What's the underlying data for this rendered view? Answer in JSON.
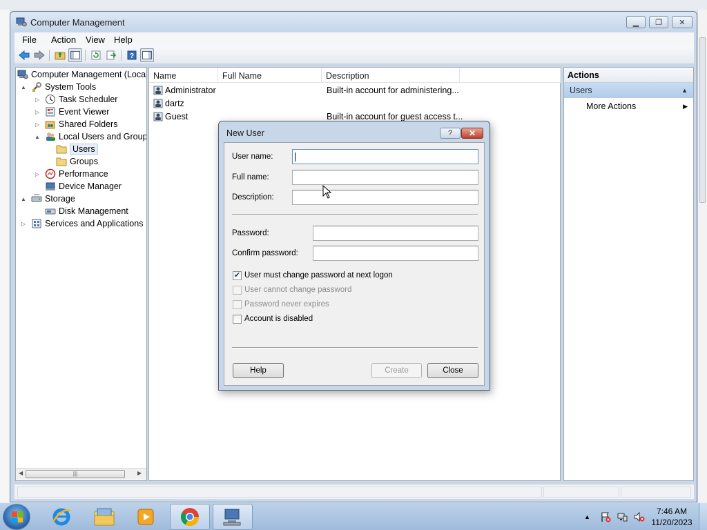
{
  "window": {
    "title": "Computer Management"
  },
  "menu": [
    "File",
    "Action",
    "View",
    "Help"
  ],
  "tree": {
    "items": [
      {
        "label": "Computer Management (Local",
        "expander": "",
        "icon": "computer-management-icon"
      },
      {
        "label": "System Tools",
        "expander": "▲",
        "icon": "system-tools-icon"
      },
      {
        "label": "Task Scheduler",
        "expander": "▷",
        "icon": "task-scheduler-icon"
      },
      {
        "label": "Event Viewer",
        "expander": "▷",
        "icon": "event-viewer-icon"
      },
      {
        "label": "Shared Folders",
        "expander": "▷",
        "icon": "shared-folders-icon"
      },
      {
        "label": "Local Users and Groups",
        "expander": "▲",
        "icon": "local-users-groups-icon"
      },
      {
        "label": "Users",
        "expander": "",
        "icon": "folder-icon"
      },
      {
        "label": "Groups",
        "expander": "",
        "icon": "folder-icon"
      },
      {
        "label": "Performance",
        "expander": "▷",
        "icon": "performance-icon"
      },
      {
        "label": "Device Manager",
        "expander": "",
        "icon": "device-manager-icon"
      },
      {
        "label": "Storage",
        "expander": "▲",
        "icon": "storage-icon"
      },
      {
        "label": "Disk Management",
        "expander": "",
        "icon": "disk-management-icon"
      },
      {
        "label": "Services and Applications",
        "expander": "▷",
        "icon": "services-applications-icon"
      }
    ]
  },
  "list": {
    "columns": [
      "Name",
      "Full Name",
      "Description"
    ],
    "rows": [
      {
        "name": "Administrator",
        "full_name": "",
        "description": "Built-in account for administering..."
      },
      {
        "name": "dartz",
        "full_name": "",
        "description": ""
      },
      {
        "name": "Guest",
        "full_name": "",
        "description": "Built-in account for guest access t..."
      }
    ]
  },
  "actions": {
    "header": "Actions",
    "section": "Users",
    "more": "More Actions"
  },
  "dialog": {
    "title": "New User",
    "help_glyph": "?",
    "close_glyph": "✕",
    "fields": {
      "username_label": "User name:",
      "username_value": "",
      "fullname_label": "Full name:",
      "fullname_value": "",
      "description_label": "Description:",
      "description_value": "",
      "password_label": "Password:",
      "password_value": "",
      "confirm_label": "Confirm password:",
      "confirm_value": ""
    },
    "checkboxes": [
      {
        "label": "User must change password at next logon",
        "checked": true,
        "disabled": false
      },
      {
        "label": "User cannot change password",
        "checked": false,
        "disabled": true
      },
      {
        "label": "Password never expires",
        "checked": false,
        "disabled": true
      },
      {
        "label": "Account is disabled",
        "checked": false,
        "disabled": false
      }
    ],
    "buttons": {
      "help": "Help",
      "create": "Create",
      "close": "Close"
    }
  },
  "taskbar": {
    "apps": [
      "internet-explorer-icon",
      "file-explorer-icon",
      "media-player-icon",
      "chrome-icon",
      "computer-management-icon"
    ],
    "time": "7:46 AM",
    "date": "11/20/2023"
  },
  "colors": {
    "accent": "#3a77c7",
    "window_frame": "#c9d8e9",
    "close_red": "#c1402c"
  }
}
